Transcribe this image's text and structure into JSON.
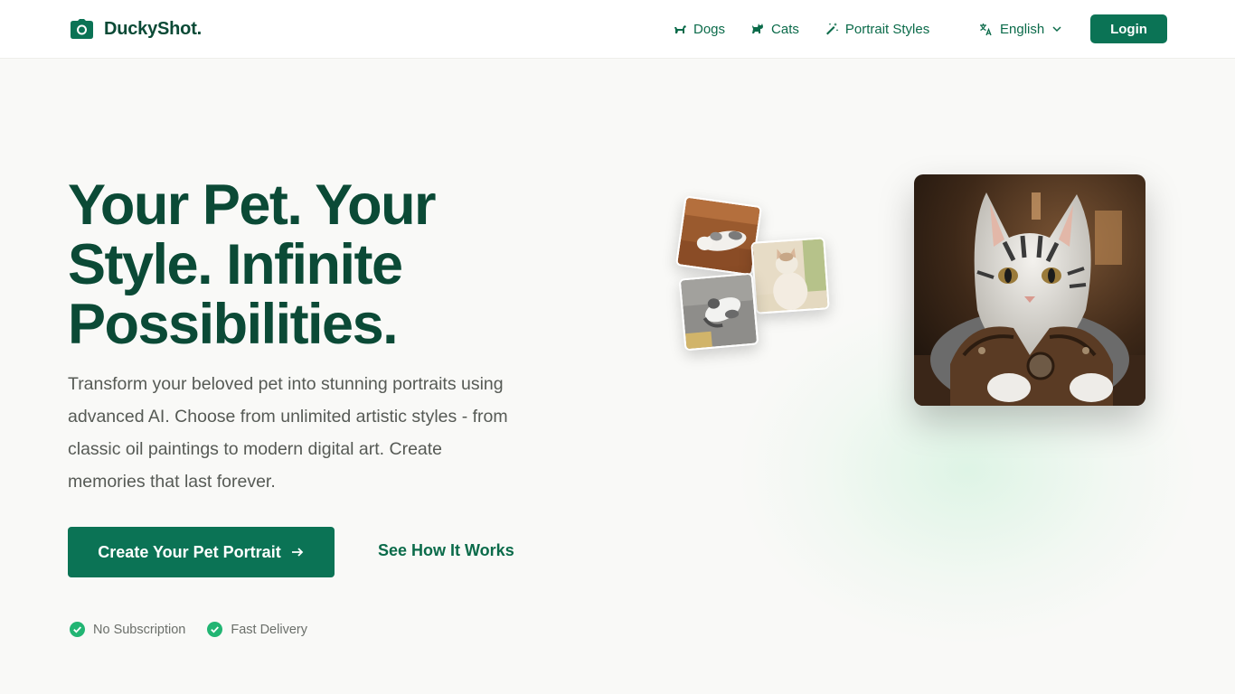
{
  "brand": {
    "name": "DuckyShot."
  },
  "nav": {
    "items": [
      {
        "label": "Dogs",
        "icon": "dog-icon"
      },
      {
        "label": "Cats",
        "icon": "cat-icon"
      },
      {
        "label": "Portrait Styles",
        "icon": "magic-wand-icon"
      }
    ],
    "language": "English",
    "login_label": "Login"
  },
  "hero": {
    "title": "Your Pet. Your Style. Infinite Possibilities.",
    "description": "Transform your beloved pet into stunning portraits using advanced AI. Choose from unlimited artistic styles - from classic oil paintings to modern digital art. Create memories that last forever.",
    "cta_label": "Create Your Pet Portrait",
    "secondary_label": "See How It Works",
    "features": [
      "No Subscription",
      "Fast Delivery"
    ]
  },
  "colors": {
    "brand_dark": "#0b4a36",
    "accent": "#0b7355",
    "check": "#22b573",
    "background": "#f9f9f7"
  }
}
